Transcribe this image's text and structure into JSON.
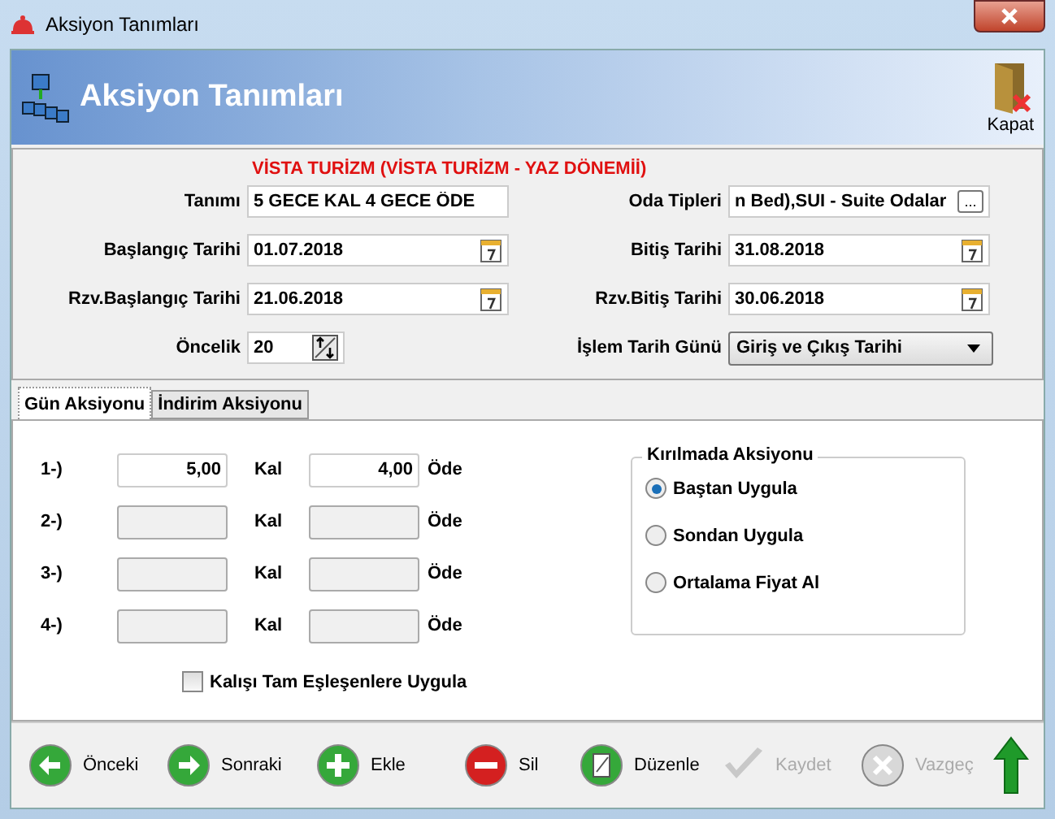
{
  "window": {
    "title": "Aksiyon Tanımları"
  },
  "header": {
    "title": "Aksiyon Tanımları",
    "close_label": "Kapat"
  },
  "form": {
    "agency": "VİSTA TURİZM (VİSTA TURİZM - YAZ DÖNEMİİ)",
    "left_fields": [
      {
        "label": "Tanımı",
        "value": "5 GECE KAL 4 GECE ÖDE",
        "kind": "text"
      },
      {
        "label": "Başlangıç Tarihi",
        "value": "01.07.2018",
        "kind": "date"
      },
      {
        "label": "Rzv.Başlangıç Tarihi",
        "value": "21.06.2018",
        "kind": "date"
      },
      {
        "label": "Öncelik",
        "value": "20",
        "kind": "spin"
      }
    ],
    "right_fields": [
      {
        "label": "Oda Tipleri",
        "value": "n Bed),SUI - Suite Odalar",
        "kind": "picker",
        "button": "..."
      },
      {
        "label": "Bitiş Tarihi",
        "value": "31.08.2018",
        "kind": "date"
      },
      {
        "label": "Rzv.Bitiş Tarihi",
        "value": "30.06.2018",
        "kind": "date"
      },
      {
        "label": "İşlem Tarih Günü",
        "value": "Giriş ve Çıkış Tarihi",
        "kind": "combo"
      }
    ]
  },
  "tabs": [
    {
      "label": "Gün Aksiyonu",
      "selected": true
    },
    {
      "label": "İndirim Aksiyonu",
      "selected": false
    }
  ],
  "actions": [
    {
      "index": "1-)",
      "stay": "5,00",
      "stay_label": "Kal",
      "pay": "4,00",
      "pay_label": "Öde",
      "disabled": false
    },
    {
      "index": "2-)",
      "stay_label": "Kal",
      "pay_label": "Öde",
      "disabled": true
    },
    {
      "index": "3-)",
      "stay_label": "Kal",
      "pay_label": "Öde",
      "disabled": true
    },
    {
      "index": "4-)",
      "stay_label": "Kal",
      "pay_label": "Öde",
      "disabled": true
    }
  ],
  "exact_match": {
    "label": "Kalışı Tam Eşleşenlere Uygula",
    "checked": false
  },
  "break_action": {
    "title": "Kırılmada Aksiyonu",
    "options": [
      {
        "label": "Baştan Uygula",
        "selected": true
      },
      {
        "label": "Sondan Uygula",
        "selected": false
      },
      {
        "label": "Ortalama Fiyat Al",
        "selected": false
      }
    ]
  },
  "toolbar": [
    {
      "kind": "prev",
      "label": "Önceki",
      "disabled": false
    },
    {
      "kind": "next",
      "label": "Sonraki",
      "disabled": false
    },
    {
      "kind": "add",
      "label": "Ekle",
      "disabled": false
    },
    {
      "kind": "delete",
      "label": "Sil",
      "disabled": false
    },
    {
      "kind": "edit",
      "label": "Düzenle",
      "disabled": false
    },
    {
      "kind": "save",
      "label": "Kaydet",
      "disabled": true
    },
    {
      "kind": "cancel",
      "label": "Vazgeç",
      "disabled": true
    },
    {
      "kind": "up",
      "disabled": false
    }
  ]
}
